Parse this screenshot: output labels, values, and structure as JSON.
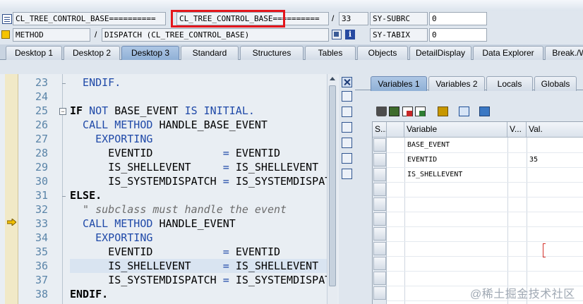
{
  "header": {
    "row1": {
      "program": "CL_TREE_CONTROL_BASE==========",
      "include": "CL_TREE_CONTROL_BASE==========",
      "line": "33",
      "sysfield_name": "SY-SUBRC",
      "sysfield_value": "0"
    },
    "row2": {
      "event_type": "METHOD",
      "event": "DISPATCH (CL_TREE_CONTROL_BASE)",
      "sysfield_name": "SY-TABIX",
      "sysfield_value": "0"
    },
    "separator": "/"
  },
  "desktop_tabs": [
    "Desktop 1",
    "Desktop 2",
    "Desktop 3",
    "Standard",
    "Structures",
    "Tables",
    "Objects",
    "DetailDisplay",
    "Data Explorer",
    "Break./W"
  ],
  "active_desktop_tab": "Desktop 3",
  "editor": {
    "lines": [
      {
        "num": "23",
        "segments": [
          {
            "t": "  ENDIF.",
            "c": "kw"
          }
        ]
      },
      {
        "num": "24",
        "segments": []
      },
      {
        "num": "25",
        "segments": [
          {
            "t": "IF ",
            "c": "kwb"
          },
          {
            "t": "NOT ",
            "c": "kw"
          },
          {
            "t": "BASE_EVENT ",
            "c": "tx"
          },
          {
            "t": "IS INITIAL.",
            "c": "kw"
          }
        ]
      },
      {
        "num": "26",
        "segments": [
          {
            "t": "  CALL METHOD ",
            "c": "kw"
          },
          {
            "t": "HANDLE_BASE_EVENT",
            "c": "tx"
          }
        ]
      },
      {
        "num": "27",
        "segments": [
          {
            "t": "    EXPORTING",
            "c": "kw"
          }
        ]
      },
      {
        "num": "28",
        "segments": [
          {
            "t": "      EVENTID           ",
            "c": "tx"
          },
          {
            "t": "= ",
            "c": "kw"
          },
          {
            "t": "EVENTID",
            "c": "tx"
          }
        ]
      },
      {
        "num": "29",
        "segments": [
          {
            "t": "      IS_SHELLEVENT     ",
            "c": "tx"
          },
          {
            "t": "= ",
            "c": "kw"
          },
          {
            "t": "IS_SHELLEVENT",
            "c": "tx"
          }
        ]
      },
      {
        "num": "30",
        "segments": [
          {
            "t": "      IS_SYSTEMDISPATCH ",
            "c": "tx"
          },
          {
            "t": "= ",
            "c": "kw"
          },
          {
            "t": "IS_SYSTEMDISPATCH",
            "c": "tx"
          }
        ]
      },
      {
        "num": "31",
        "segments": [
          {
            "t": "ELSE.",
            "c": "kwb"
          }
        ]
      },
      {
        "num": "32",
        "segments": [
          {
            "t": "  \" subclass must handle the event",
            "c": "cm"
          }
        ]
      },
      {
        "num": "33",
        "segments": [
          {
            "t": "  CALL METHOD ",
            "c": "kw"
          },
          {
            "t": "HANDLE_EVENT",
            "c": "tx"
          }
        ]
      },
      {
        "num": "34",
        "segments": [
          {
            "t": "    EXPORTING",
            "c": "kw"
          }
        ]
      },
      {
        "num": "35",
        "segments": [
          {
            "t": "      EVENTID           ",
            "c": "tx"
          },
          {
            "t": "= ",
            "c": "kw"
          },
          {
            "t": "EVENTID",
            "c": "tx"
          }
        ]
      },
      {
        "num": "36",
        "segments": [
          {
            "t": "      IS_SHELLEVENT     ",
            "c": "tx"
          },
          {
            "t": "= ",
            "c": "kw"
          },
          {
            "t": "IS_SHELLEVENT",
            "c": "tx"
          }
        ]
      },
      {
        "num": "37",
        "segments": [
          {
            "t": "      IS_SYSTEMDISPATCH ",
            "c": "tx"
          },
          {
            "t": "= ",
            "c": "kw"
          },
          {
            "t": "IS_SYSTEMDISPATCH",
            "c": "tx"
          }
        ]
      },
      {
        "num": "38",
        "segments": [
          {
            "t": "ENDIF.",
            "c": "kwb"
          }
        ]
      }
    ],
    "breakpoint_line": "33",
    "highlight_line": "36"
  },
  "right_panel": {
    "tabs": [
      "Variables 1",
      "Variables 2",
      "Locals",
      "Globals"
    ],
    "active_tab": "Variables 1",
    "columns": [
      "S...",
      "Variable",
      "V...",
      "Val."
    ],
    "rows": [
      {
        "variable": "BASE_EVENT",
        "value": ""
      },
      {
        "variable": "EVENTID",
        "value": "35"
      },
      {
        "variable": "IS_SHELLEVENT",
        "value": ""
      }
    ]
  },
  "watermark": "@稀土掘金技术社区",
  "colors": {
    "keyword": "#1f49a8",
    "highlight_box": "#e4161c",
    "active_tab": "#8fb0d6",
    "gutter": "#f1e9c7"
  }
}
